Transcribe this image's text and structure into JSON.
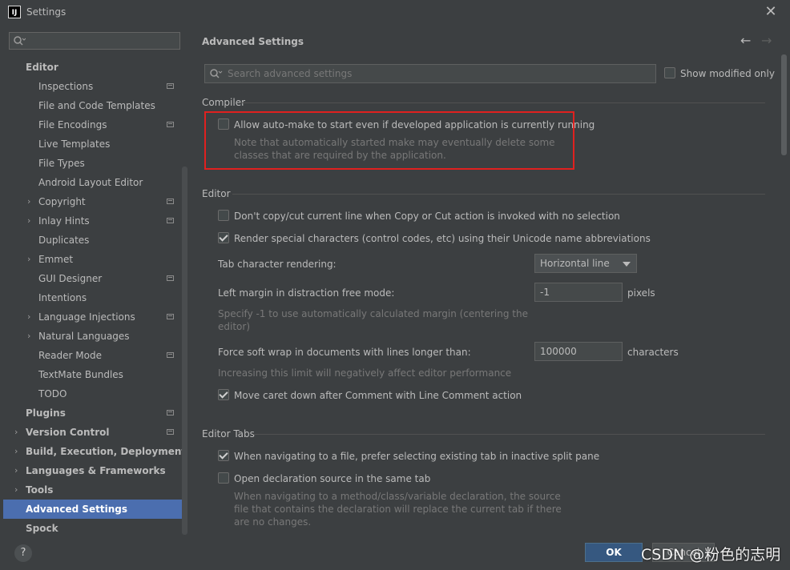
{
  "window": {
    "app_icon_text": "IJ",
    "title": "Settings",
    "close_glyph": "✕"
  },
  "sidebar": {
    "search": {
      "value": "",
      "placeholder": ""
    },
    "items": [
      {
        "label": "Editor",
        "level": 0,
        "bold": true
      },
      {
        "label": "Inspections",
        "level": 1,
        "project_icon": true
      },
      {
        "label": "File and Code Templates",
        "level": 1
      },
      {
        "label": "File Encodings",
        "level": 1,
        "project_icon": true
      },
      {
        "label": "Live Templates",
        "level": 1
      },
      {
        "label": "File Types",
        "level": 1
      },
      {
        "label": "Android Layout Editor",
        "level": 1
      },
      {
        "label": "Copyright",
        "level": 1,
        "expandable": true,
        "project_icon": true
      },
      {
        "label": "Inlay Hints",
        "level": 1,
        "expandable": true,
        "project_icon": true
      },
      {
        "label": "Duplicates",
        "level": 1
      },
      {
        "label": "Emmet",
        "level": 1,
        "expandable": true
      },
      {
        "label": "GUI Designer",
        "level": 1,
        "project_icon": true
      },
      {
        "label": "Intentions",
        "level": 1
      },
      {
        "label": "Language Injections",
        "level": 1,
        "expandable": true,
        "project_icon": true
      },
      {
        "label": "Natural Languages",
        "level": 1,
        "expandable": true
      },
      {
        "label": "Reader Mode",
        "level": 1,
        "project_icon": true
      },
      {
        "label": "TextMate Bundles",
        "level": 1
      },
      {
        "label": "TODO",
        "level": 1
      },
      {
        "label": "Plugins",
        "level": 0,
        "bold": true,
        "project_icon": true
      },
      {
        "label": "Version Control",
        "level": 0,
        "bold": true,
        "expandable": true,
        "project_icon": true
      },
      {
        "label": "Build, Execution, Deployment",
        "level": 0,
        "bold": true,
        "expandable": true
      },
      {
        "label": "Languages & Frameworks",
        "level": 0,
        "bold": true,
        "expandable": true
      },
      {
        "label": "Tools",
        "level": 0,
        "bold": true,
        "expandable": true
      },
      {
        "label": "Advanced Settings",
        "level": 0,
        "bold": true,
        "selected": true
      },
      {
        "label": "Spock",
        "level": 0,
        "bold": true
      }
    ]
  },
  "main": {
    "title": "Advanced Settings",
    "back_glyph": "←",
    "forward_glyph": "→",
    "search": {
      "value": "",
      "placeholder": "Search advanced settings"
    },
    "show_modified_only": {
      "label": "Show modified only",
      "checked": false
    },
    "compiler": {
      "header": "Compiler",
      "auto_make": {
        "label": "Allow auto-make to start even if developed application is currently running",
        "checked": false,
        "hint_line1": "Note that automatically started make may eventually delete some",
        "hint_line2": "classes that are required by the application."
      }
    },
    "editor": {
      "header": "Editor",
      "no_copy_cut": {
        "label": "Don't copy/cut current line when Copy or Cut action is invoked with no selection",
        "checked": false
      },
      "render_special": {
        "label": "Render special characters (control codes, etc) using their Unicode name abbreviations",
        "checked": true
      },
      "tab_rendering": {
        "label": "Tab character rendering:",
        "value": "Horizontal line"
      },
      "left_margin": {
        "label": "Left margin in distraction free mode:",
        "value": "-1",
        "unit": "pixels",
        "hint_line1": "Specify -1 to use automatically calculated margin (centering the",
        "hint_line2": "editor)"
      },
      "soft_wrap": {
        "label": "Force soft wrap in documents with lines longer than:",
        "value": "100000",
        "unit": "characters",
        "hint": "Increasing this limit will negatively affect editor performance"
      },
      "move_caret": {
        "label": "Move caret down after Comment with Line Comment action",
        "checked": true
      }
    },
    "editor_tabs": {
      "header": "Editor Tabs",
      "prefer_existing": {
        "label": "When navigating to a file, prefer selecting existing tab in inactive split pane",
        "checked": true
      },
      "open_same_tab": {
        "label": "Open declaration source in the same tab",
        "checked": false,
        "hint_line1": "When navigating to a method/class/variable declaration, the source",
        "hint_line2": "file that contains the declaration will replace the current tab if there",
        "hint_line3": "are no changes."
      }
    }
  },
  "footer": {
    "help_label": "?",
    "ok_label": "OK",
    "cancel_label": "Cancel",
    "watermark": "CSDN @粉色的志明"
  },
  "colors": {
    "accent": "#4b6eaf",
    "highlight_box": "#e0211f",
    "ok_button": "#365880"
  }
}
